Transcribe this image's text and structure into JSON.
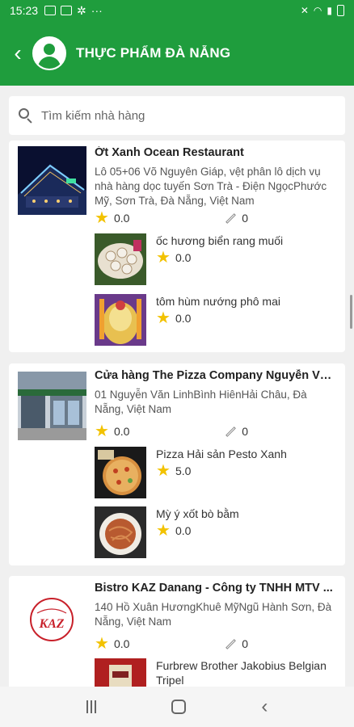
{
  "status_bar": {
    "time": "15:23",
    "more": "···"
  },
  "app_bar": {
    "back": "‹",
    "title": "THỰC PHẨM ĐÀ NẴNG"
  },
  "search": {
    "placeholder": "Tìm kiếm nhà hàng"
  },
  "restaurants": [
    {
      "name": "Ớt Xanh Ocean Restaurant",
      "address": "Lô 05+06 Võ Nguyên Giáp, vệt phân lô dịch vụ nhà hàng dọc tuyến Sơn Trà - Điện NgọcPhước Mỹ, Sơn Trà, Đà Nẵng, Việt Nam",
      "rating": "0.0",
      "reviews": "0",
      "dishes": [
        {
          "name": "ốc hương biển rang muối",
          "rating": "0.0"
        },
        {
          "name": "tôm hùm nướng phô mai",
          "rating": "0.0"
        }
      ]
    },
    {
      "name": "Cửa hàng The Pizza Company Nguyễn Văn...",
      "address": "01 Nguyễn Văn LinhBình HiênHải Châu, Đà Nẵng, Việt Nam",
      "rating": "0.0",
      "reviews": "0",
      "dishes": [
        {
          "name": "Pizza Hải sản Pesto Xanh",
          "rating": "5.0"
        },
        {
          "name": "Mỳ ý xốt bò bằm",
          "rating": "0.0"
        }
      ]
    },
    {
      "name": "Bistro KAZ Danang - Công ty TNHH MTV ...",
      "address": "140 Hồ Xuân HươngKhuê MỹNgũ Hành Sơn, Đà Nẵng, Việt Nam",
      "rating": "0.0",
      "reviews": "0",
      "logo_text": "KAZ",
      "dishes": [
        {
          "name": "Furbrew Brother Jakobius Belgian Tripel",
          "rating": ""
        }
      ]
    }
  ],
  "colors": {
    "primary": "#1f9d3d",
    "star": "#f2c200"
  }
}
